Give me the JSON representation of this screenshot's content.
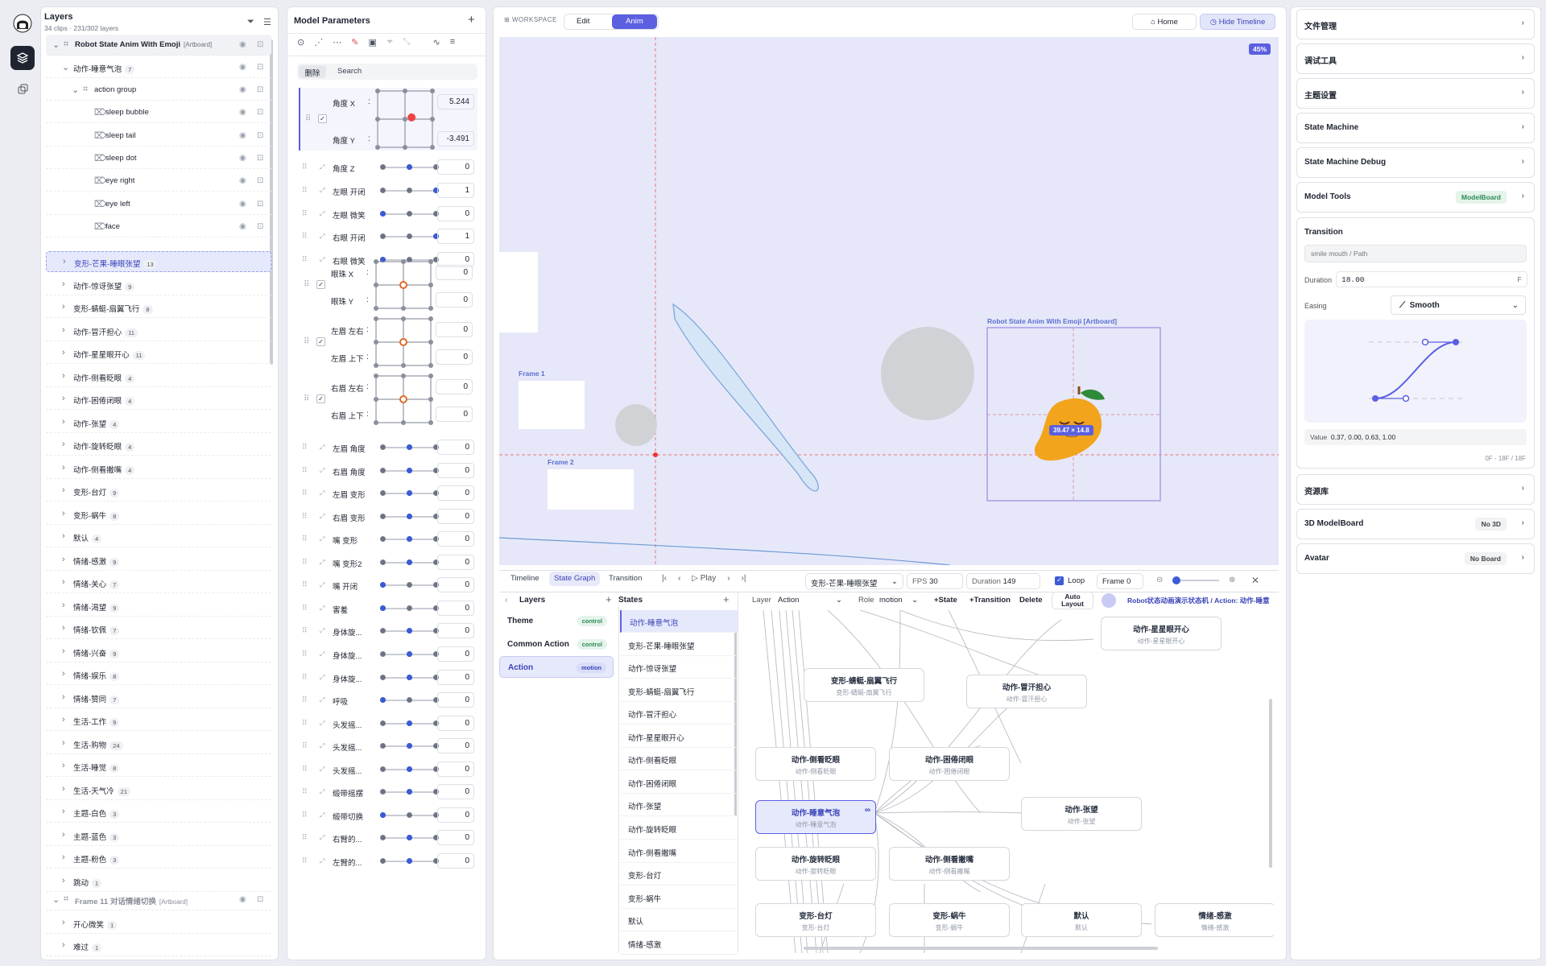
{
  "layers": {
    "title": "Layers",
    "subtitle": "34 clips · 231/302 layers",
    "rows": [
      {
        "name": "Robot State Anim With Emoji",
        "tag": "[Artboard]",
        "count": ""
      },
      {
        "name": "动作-睡意气泡",
        "count": "7"
      },
      {
        "name": "action group",
        "count": ""
      },
      {
        "name": "sleep bubble",
        "count": ""
      },
      {
        "name": "sleep tail",
        "count": ""
      },
      {
        "name": "sleep dot",
        "count": ""
      },
      {
        "name": "eye right",
        "count": ""
      },
      {
        "name": "eye left",
        "count": ""
      },
      {
        "name": "face",
        "count": ""
      },
      {
        "name": "变形-芒果-睡眼张望",
        "count": "13"
      },
      {
        "name": "动作-惊讶张望",
        "count": "9"
      },
      {
        "name": "变形-蜻蜓-扇翼飞行",
        "count": "8"
      },
      {
        "name": "动作-冒汗担心",
        "count": "11"
      },
      {
        "name": "动作-星星眼开心",
        "count": "11"
      },
      {
        "name": "动作-侧看眨眼",
        "count": "4"
      },
      {
        "name": "动作-困倦闭眼",
        "count": "4"
      },
      {
        "name": "动作-张望",
        "count": "4"
      },
      {
        "name": "动作-旋转眨眼",
        "count": "4"
      },
      {
        "name": "动作-侧看撇嘴",
        "count": "4"
      },
      {
        "name": "变形-台灯",
        "count": "9"
      },
      {
        "name": "变形-蜗牛",
        "count": "8"
      },
      {
        "name": "默认",
        "count": "4"
      },
      {
        "name": "情绪-感激",
        "count": "9"
      },
      {
        "name": "情绪-关心",
        "count": "7"
      },
      {
        "name": "情绪-渴望",
        "count": "9"
      },
      {
        "name": "情绪-钦佩",
        "count": "7"
      },
      {
        "name": "情绪-兴奋",
        "count": "9"
      },
      {
        "name": "情绪-娱乐",
        "count": "8"
      },
      {
        "name": "情绪-赞同",
        "count": "7"
      },
      {
        "name": "生活-工作",
        "count": "9"
      },
      {
        "name": "生活-购物",
        "count": "24"
      },
      {
        "name": "生活-睡觉",
        "count": "8"
      },
      {
        "name": "生活-天气冷",
        "count": "21"
      },
      {
        "name": "主题-白色",
        "count": "3"
      },
      {
        "name": "主题-蓝色",
        "count": "3"
      },
      {
        "name": "主题-粉色",
        "count": "3"
      },
      {
        "name": "跳动",
        "count": "1"
      },
      {
        "name": "Frame 11 对话情绪切换",
        "tag": "[Artboard]",
        "count": ""
      },
      {
        "name": "开心微笑",
        "count": "1"
      },
      {
        "name": "难过",
        "count": "1"
      }
    ]
  },
  "params": {
    "title": "Model Parameters",
    "tab_active": "删除",
    "tab_search": "Search",
    "grids": [
      {
        "l1": "角度 X",
        "v1": "5.244",
        "l2": "角度 Y",
        "v2": "-3.491"
      },
      {
        "l1": "眼珠 X",
        "v1": "0",
        "l2": "眼珠 Y",
        "v2": "0"
      },
      {
        "l1": "左眉 左右",
        "v1": "0",
        "l2": "左眉 上下",
        "v2": "0"
      },
      {
        "l1": "右眉 左右",
        "v1": "0",
        "l2": "右眉 上下",
        "v2": "0"
      }
    ],
    "rows1": [
      {
        "l": "角度 Z",
        "v": "0",
        "p": 0.5
      },
      {
        "l": "左眼 开闭",
        "v": "1",
        "p": 1
      },
      {
        "l": "左眼 微笑",
        "v": "0",
        "p": 0
      },
      {
        "l": "右眼 开闭",
        "v": "1",
        "p": 1
      },
      {
        "l": "右眼 微笑",
        "v": "0",
        "p": 0
      }
    ],
    "rows2": [
      {
        "l": "左眉 角度",
        "v": "0",
        "p": 0.5
      },
      {
        "l": "右眉 角度",
        "v": "0",
        "p": 0.5
      },
      {
        "l": "左眉 变形",
        "v": "0",
        "p": 0.5
      },
      {
        "l": "右眉 变形",
        "v": "0",
        "p": 0.5
      },
      {
        "l": "嘴 变形",
        "v": "0",
        "p": 0.5
      },
      {
        "l": "嘴 变形2",
        "v": "0",
        "p": 0.5
      },
      {
        "l": "嘴 开闭",
        "v": "0",
        "p": 0
      },
      {
        "l": "害羞",
        "v": "0",
        "p": 0
      },
      {
        "l": "身体旋...",
        "v": "0",
        "p": 0.5
      },
      {
        "l": "身体旋...",
        "v": "0",
        "p": 0.5
      },
      {
        "l": "身体旋...",
        "v": "0",
        "p": 0.5
      },
      {
        "l": "呼吸",
        "v": "0",
        "p": 0
      },
      {
        "l": "头发摇...",
        "v": "0",
        "p": 0.5
      },
      {
        "l": "头发摇...",
        "v": "0",
        "p": 0.5
      },
      {
        "l": "头发摇...",
        "v": "0",
        "p": 0.5
      },
      {
        "l": "缎带摇摆",
        "v": "0",
        "p": 0.5
      },
      {
        "l": "缎带切换",
        "v": "0",
        "p": 0
      },
      {
        "l": "右臂的...",
        "v": "0",
        "p": 0.5
      },
      {
        "l": "左臂的...",
        "v": "0",
        "p": 0.5
      }
    ]
  },
  "workspace": {
    "label": "WORKSPACE",
    "edit": "Edit",
    "anim": "Anim",
    "home": "Home",
    "hide_timeline": "Hide Timeline"
  },
  "canvas": {
    "zoom": "45%",
    "frame1": "Frame 1",
    "frame2": "Frame 2",
    "artboard": "Robot State Anim With Emoji [Artboard]",
    "size_badge": "39.47 × 14.8"
  },
  "timeline": {
    "tabs": [
      "Timeline",
      "State Graph",
      "Transition"
    ],
    "play": "Play",
    "state_select": "变形-芒果-睡眼张望",
    "fps_label": "FPS",
    "fps": "30",
    "duration_label": "Duration",
    "duration": "149",
    "loop": "Loop",
    "frame": "Frame 0",
    "layers_title": "Layers",
    "states_title": "States",
    "layers": [
      {
        "name": "Theme",
        "role": "control"
      },
      {
        "name": "Common Action",
        "role": "control"
      },
      {
        "name": "Action",
        "role": "motion"
      }
    ],
    "layer_label": "Layer",
    "layer_value": "Action",
    "role_label": "Role",
    "role_value": "motion",
    "add_state": "+State",
    "add_transition": "+Transition",
    "delete": "Delete",
    "auto_layout": "Auto Layout",
    "breadcrumb": "Robot状态动画演示状态机 / Action: 动作-睡意",
    "states": [
      "动作-睡意气泡",
      "变形-芒果-睡眼张望",
      "动作-惊讶张望",
      "变形-蜻蜓-扇翼飞行",
      "动作-冒汗担心",
      "动作-星星眼开心",
      "动作-侧看眨眼",
      "动作-困倦闭眼",
      "动作-张望",
      "动作-旋转眨眼",
      "动作-侧看撇嘴",
      "变形-台灯",
      "变形-蜗牛",
      "默认",
      "情绪-感激"
    ],
    "nodes": [
      {
        "t": "动作-星星眼开心",
        "s": "动作-星星眼开心"
      },
      {
        "t": "变形-蜻蜓-扇翼飞行",
        "s": "变形-蜻蜓-扇翼飞行"
      },
      {
        "t": "动作-冒汗担心",
        "s": "动作-冒汗担心"
      },
      {
        "t": "动作-侧看眨眼",
        "s": "动作-侧看眨眼"
      },
      {
        "t": "动作-困倦闭眼",
        "s": "动作-困倦闭眼"
      },
      {
        "t": "动作-睡意气泡",
        "s": "动作-睡意气泡"
      },
      {
        "t": "动作-张望",
        "s": "动作-张望"
      },
      {
        "t": "动作-旋转眨眼",
        "s": "动作-旋转眨眼"
      },
      {
        "t": "动作-侧看撇嘴",
        "s": "动作-侧看撇嘴"
      },
      {
        "t": "变形-台灯",
        "s": "变形-台灯"
      },
      {
        "t": "变形-蜗牛",
        "s": "变形-蜗牛"
      },
      {
        "t": "默认",
        "s": "默认"
      },
      {
        "t": "情绪-感激",
        "s": "情绪-感激"
      }
    ]
  },
  "right": {
    "p1": "文件管理",
    "p2": "调试工具",
    "p3": "主题设置",
    "p4": "State Machine",
    "p5": "State Machine Debug",
    "p6": "Model Tools",
    "p6_tag": "ModelBoard",
    "transition_title": "Transition",
    "transition_path": "smile mouth / Path",
    "duration_label": "Duration",
    "duration": "18.00",
    "duration_unit": "F",
    "easing_label": "Easing",
    "easing": "Smooth",
    "value_label": "Value",
    "value": "0.37, 0.00, 0.63, 1.00",
    "frame_range": "0F - 18F / 18F",
    "p7": "资源库",
    "p8": "3D ModelBoard",
    "p8_tag": "No 3D",
    "p9": "Avatar",
    "p9_tag": "No Board",
    "colors": {
      "accent": "#5b5fe0",
      "badge_green": "#2e8b57"
    }
  }
}
